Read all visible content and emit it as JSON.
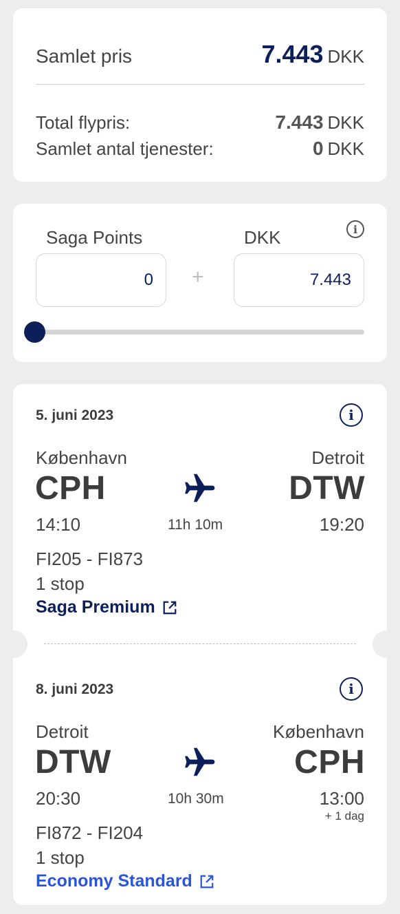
{
  "price_summary": {
    "total_label": "Samlet pris",
    "total_amount": "7.443",
    "total_currency": "DKK",
    "lines": [
      {
        "label": "Total flypris:",
        "amount": "7.443",
        "currency": "DKK"
      },
      {
        "label": "Samlet antal tjenester:",
        "amount": "0",
        "currency": "DKK"
      }
    ]
  },
  "points": {
    "points_label": "Saga Points",
    "dkk_label": "DKK",
    "points_value": "0",
    "dkk_value": "7.443",
    "plus_symbol": "+",
    "info_icon": "info-icon",
    "slider_value": 0
  },
  "flights": [
    {
      "date": "5. juni 2023",
      "from_city": "København",
      "from_code": "CPH",
      "to_city": "Detroit",
      "to_code": "DTW",
      "depart_time": "14:10",
      "arrive_time": "19:20",
      "arrive_note": "",
      "duration": "11h 10m",
      "flight_numbers": "FI205 - FI873",
      "stops": "1 stop",
      "fare": "Saga Premium",
      "fare_color": "#0c1f5b",
      "icon": "airplane-icon"
    },
    {
      "date": "8. juni 2023",
      "from_city": "Detroit",
      "from_code": "DTW",
      "to_city": "København",
      "to_code": "CPH",
      "depart_time": "20:30",
      "arrive_time": "13:00",
      "arrive_note": "+ 1 dag",
      "duration": "10h 30m",
      "flight_numbers": "FI872 - FI204",
      "stops": "1 stop",
      "fare": "Economy Standard",
      "fare_color": "#2a55d6",
      "icon": "airplane-icon"
    }
  ],
  "colors": {
    "brand_navy": "#0c1f5b",
    "link_blue": "#2a55d6",
    "background": "#ededed"
  }
}
